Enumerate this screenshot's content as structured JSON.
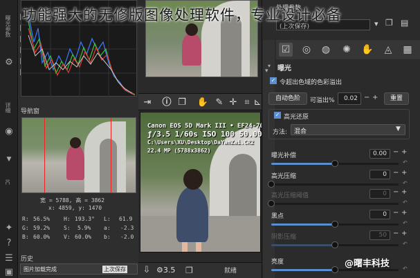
{
  "overlay_title": "功能强大的无修版图像处理软件，专业设计必备",
  "watermark": "@曙丰科技",
  "left_sidebar": {
    "tab_top": "曝光参数",
    "tab_mid": "详细",
    "tab_bottom": "IC"
  },
  "navigator": {
    "title": "导航窗",
    "size_line": "宽 = 5788, 高 = 3862",
    "coord_line": "x: 4859, y: 1470",
    "rows": [
      {
        "a": "R:",
        "av": "56.5%",
        "b": "H:",
        "bv": "193.3°",
        "c": "L:",
        "cv": "61.9"
      },
      {
        "a": "G:",
        "av": "59.2%",
        "b": "S:",
        "bv": "5.9%",
        "c": "a:",
        "cv": "-2.3"
      },
      {
        "a": "B:",
        "av": "60.0%",
        "b": "V:",
        "bv": "60.0%",
        "c": "b:",
        "cv": "-2.0"
      }
    ]
  },
  "history": {
    "title": "历史",
    "col1": "图片加载完成",
    "col2": "上次保存"
  },
  "exif": {
    "camera": "Canon EOS 5D Mark III • EF24-70",
    "exposure": "ƒ/3.5  1/60s  ISO 100  50.00mm",
    "path": "C:\\Users\\XU\\Desktop\\DaYanZai.CR2",
    "size": "22.4 MP (5788x3862)"
  },
  "bottom_bar": {
    "exp_icon": "⚙3.5",
    "queue": "就绪"
  },
  "right_panel": {
    "header": "处理参数",
    "sub_header": "(上次保存)",
    "section": "曝光",
    "auto_levels_check": "令超出色域的色彩溢出",
    "auto_levels_button": "自动色阶",
    "clip_label": "可溢出%",
    "clip_value": "0.02",
    "reset_button": "重置",
    "highlight_recovery": "高光还原",
    "method_label": "方法:",
    "method_value": "混合",
    "sliders": [
      {
        "label": "曝光补偿",
        "value": "0.00",
        "fill": 0.5
      },
      {
        "label": "高光压缩",
        "value": "0",
        "fill": 0.0
      },
      {
        "label": "高光压缩阈值",
        "value": "0",
        "fill": 0.0,
        "dim": true
      },
      {
        "label": "黑点",
        "value": "0",
        "fill": 0.5
      },
      {
        "label": "阴影压缩",
        "value": "50",
        "fill": 0.5,
        "dim": true
      },
      {
        "label": "亮度",
        "value": "",
        "fill": 0.5
      }
    ]
  }
}
